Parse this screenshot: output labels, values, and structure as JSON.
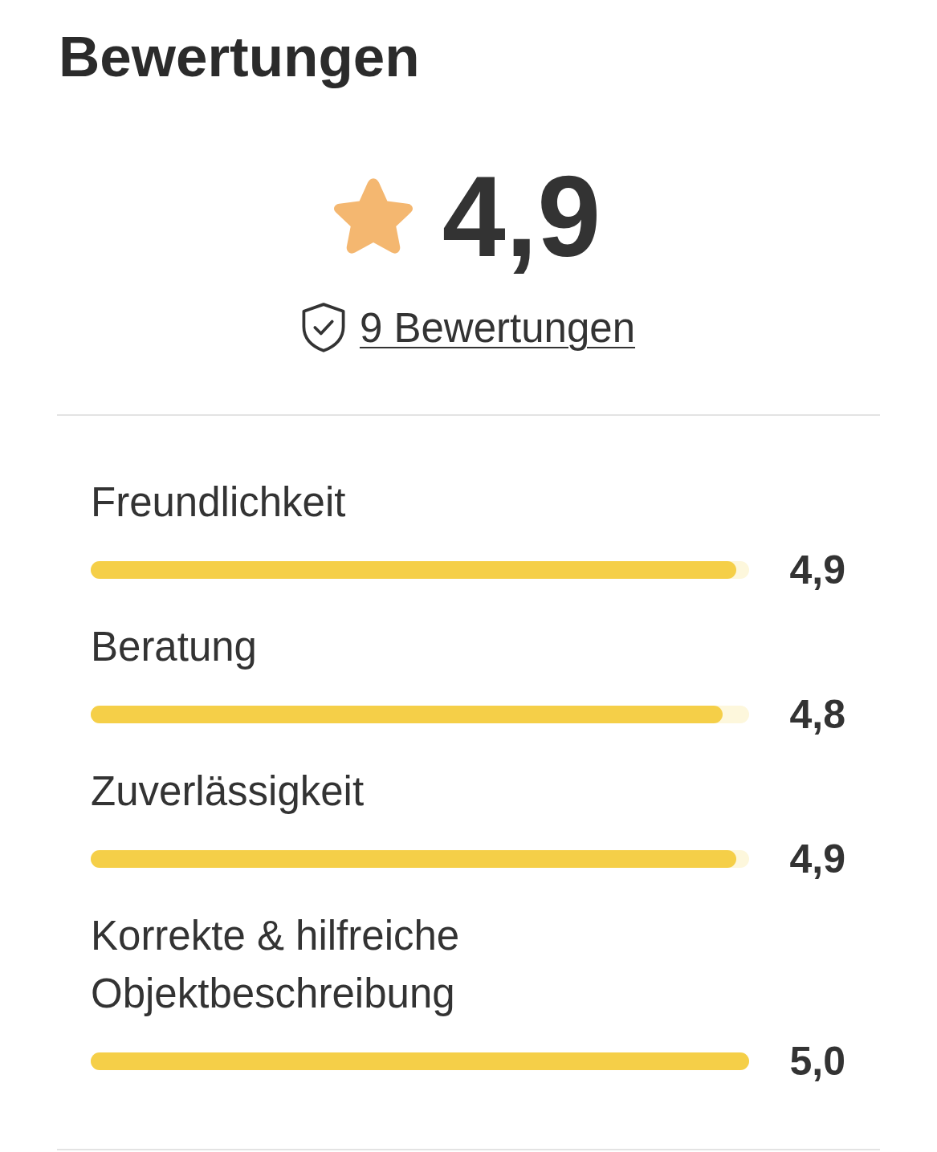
{
  "title": "Bewertungen",
  "summary": {
    "rating": "4,9",
    "reviews_link": "9 Bewertungen"
  },
  "categories": [
    {
      "label": "Freundlichkeit",
      "level": 0.98,
      "value": "4,9"
    },
    {
      "label": "Beratung",
      "level": 0.96,
      "value": "4,8"
    },
    {
      "label": "Zuverlässigkeit",
      "level": 0.98,
      "value": "4,9"
    },
    {
      "label": "Korrekte & hilfreiche Objektbeschreibung",
      "level": 1,
      "value": "5,0"
    }
  ]
}
